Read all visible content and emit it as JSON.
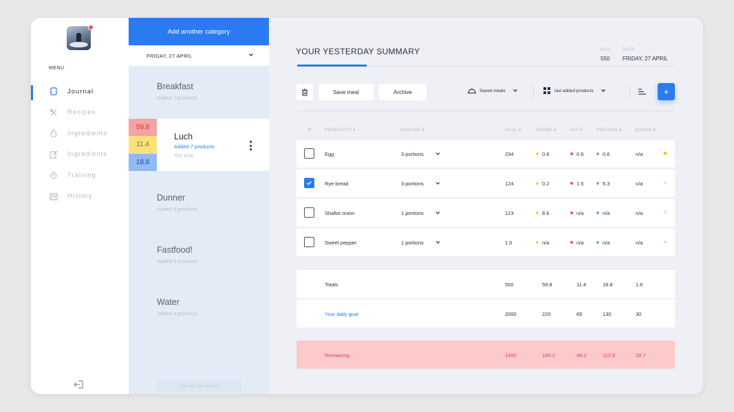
{
  "colors": {
    "accent": "#2a7bf0",
    "carbs": "#f7cf49",
    "fat": "#f0505a",
    "protein": "#6fa8f0",
    "remaining_bg": "#fccaca",
    "remaining_text": "#e0414b"
  },
  "nav": {
    "menu_title": "MENU",
    "items": [
      {
        "label": "Journal",
        "icon": "journal-icon",
        "active": true
      },
      {
        "label": "Recipes",
        "icon": "recipes-icon"
      },
      {
        "label": "Ingredients",
        "icon": "drop-icon"
      },
      {
        "label": "Ingredients",
        "icon": "edit-icon"
      },
      {
        "label": "Training",
        "icon": "stopwatch-icon"
      },
      {
        "label": "History",
        "icon": "calendar-icon"
      }
    ],
    "logout_icon": "logout-icon"
  },
  "categories_panel": {
    "add_button": "Add another category",
    "date": "FRIDAY, 27 APRIL",
    "categories": [
      {
        "name": "Breakfast",
        "sub": "Added 7 products"
      },
      {
        "name": "Luch",
        "sub": "Added 7 products",
        "kcal": "550 kcal",
        "macros": [
          "59.8",
          "11.4",
          "18.8"
        ]
      },
      {
        "name": "Dunner",
        "sub": "Added 9 products"
      },
      {
        "name": "Fastfood!",
        "sub": "Added 4 products"
      },
      {
        "name": "Water",
        "sub": "Added 4 products"
      }
    ],
    "footer": "This day has ended"
  },
  "summary": {
    "title": "YOUR YESTERDAY SUMMARY",
    "kcal_label": "KCAL",
    "kcal_value": "550",
    "date_label": "DATE",
    "date_value": "FRIDAY, 27 APRIL"
  },
  "toolbar": {
    "delete_icon": "trash-icon",
    "save_meal": "Save meal",
    "archive": "Archive",
    "saved_meals": "Saved meals",
    "last_added": "last added products",
    "sort_icon": "sort-icon",
    "add_icon": "plus-icon",
    "add_label": "+"
  },
  "table": {
    "headers": {
      "products": "PRODUCTS",
      "amount": "AMOUNT",
      "kcal": "KCAL",
      "carbs": "CARBS",
      "fat": "FAT",
      "protein": "PROTEIN",
      "sugar": "SUGAR"
    },
    "rows": [
      {
        "name": "Egg",
        "amount": "3 portions",
        "kcal": "234",
        "carbs": "0.6",
        "fat": "0.6",
        "protein": "0.6",
        "sugar": "n/a",
        "checked": false,
        "starred": true
      },
      {
        "name": "Rye bread",
        "amount": "3 portions",
        "kcal": "124",
        "carbs": "0.2",
        "fat": "1.5",
        "protein": "5.3",
        "sugar": "n/a",
        "checked": true,
        "starred": false
      },
      {
        "name": "Shallot onion",
        "amount": "1 portions",
        "kcal": "123",
        "carbs": "8.6",
        "fat": "n/a",
        "protein": "n/a",
        "sugar": "n/a",
        "checked": false,
        "starred": false
      },
      {
        "name": "Sweet pepper",
        "amount": "1 portions",
        "kcal": "1.0",
        "carbs": "n/a",
        "fat": "n/a",
        "protein": "n/a",
        "sugar": "n/a",
        "checked": false,
        "starred": false
      }
    ],
    "totals": {
      "label": "Totals",
      "kcal": "550",
      "carbs": "59.8",
      "fat": "11.4",
      "protein": "18.8",
      "sugar": "1.6"
    },
    "goal": {
      "label": "Your daily goal",
      "kcal": "2000",
      "carbs": "220",
      "fat": "65",
      "protein": "130",
      "sugar": "30"
    },
    "remaining": {
      "label": "Remaining",
      "kcal": "1450",
      "carbs": "160.2",
      "fat": "49.2",
      "protein": "112.8",
      "sugar": "28.7"
    }
  }
}
